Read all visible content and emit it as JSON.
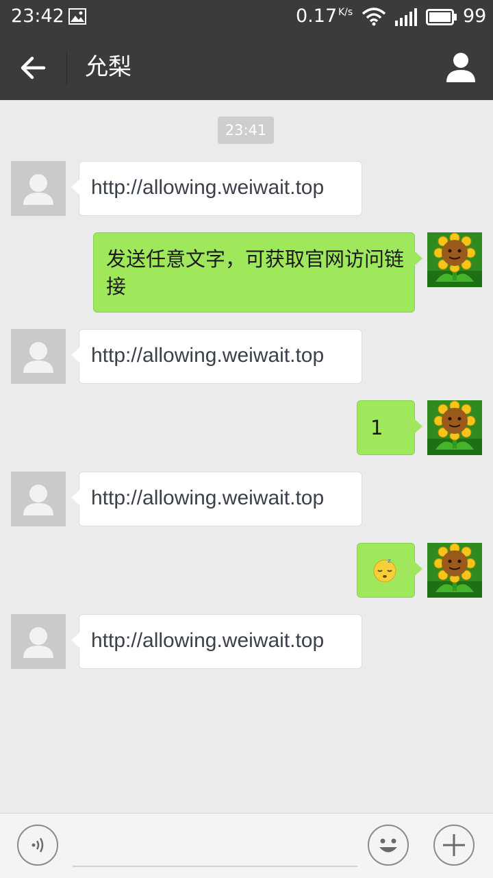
{
  "status_bar": {
    "time": "23:42",
    "network_speed": "0.17",
    "network_speed_unit": "K/s",
    "battery": "99"
  },
  "header": {
    "title": "允梨",
    "back_icon": "arrow-left-icon",
    "profile_icon": "person-icon"
  },
  "chat": {
    "timestamp": "23:41",
    "messages": [
      {
        "direction": "in",
        "text": "http://allowing.weiwait.top"
      },
      {
        "direction": "out",
        "text": "发送任意文字，可获取官网访问链接"
      },
      {
        "direction": "in",
        "text": "http://allowing.weiwait.top"
      },
      {
        "direction": "out",
        "text": "1"
      },
      {
        "direction": "in",
        "text": "http://allowing.weiwait.top"
      },
      {
        "direction": "out",
        "emoji": "sleepy-face-emoji"
      },
      {
        "direction": "in",
        "text": "http://allowing.weiwait.top"
      }
    ]
  },
  "input_bar": {
    "voice_icon": "voice-icon",
    "emoji_icon": "smiley-icon",
    "more_icon": "plus-icon"
  },
  "colors": {
    "header_bg": "#3b3b3b",
    "chat_bg": "#ebebeb",
    "outgoing_bubble": "#9fe85b",
    "incoming_bubble": "#ffffff"
  }
}
